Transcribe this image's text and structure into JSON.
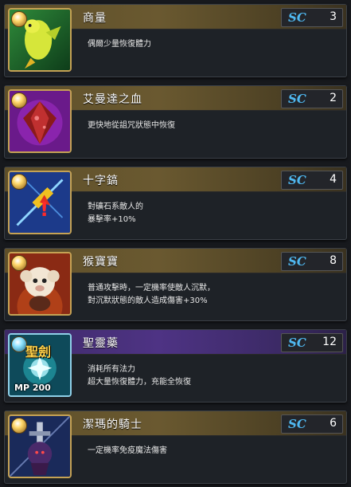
{
  "badge_label": "SC",
  "items": [
    {
      "name": "商量",
      "sc": "3",
      "desc": [
        "偶爾少量恢復體力"
      ],
      "theme": "gold",
      "icon": "green-bird-icon"
    },
    {
      "name": "艾曼達之血",
      "sc": "2",
      "desc": [
        "更快地從詛咒狀態中恢復"
      ],
      "theme": "gold",
      "icon": "blood-gem-icon"
    },
    {
      "name": "十字鎬",
      "sc": "4",
      "desc": [
        "對礦石系敵人的",
        "暴擊率+10%"
      ],
      "theme": "gold",
      "icon": "pickaxe-icon"
    },
    {
      "name": "猴寶寶",
      "sc": "8",
      "desc": [
        "普通攻擊時，一定機率使敵人沉默，",
        "對沉默狀態的敵人造成傷害+30%"
      ],
      "theme": "gold",
      "icon": "baby-monkey-icon"
    },
    {
      "name": "聖靈藥",
      "sc": "12",
      "desc": [
        "消耗所有法力",
        "超大量恢復體力，充能全恢復"
      ],
      "theme": "purple",
      "icon": "holy-potion-icon",
      "icon_kanji": "聖劍",
      "icon_mp": "MP 200"
    },
    {
      "name": "潔瑪的騎士",
      "sc": "6",
      "desc": [
        "一定機率免疫魔法傷害"
      ],
      "theme": "gold",
      "icon": "knight-icon"
    }
  ]
}
